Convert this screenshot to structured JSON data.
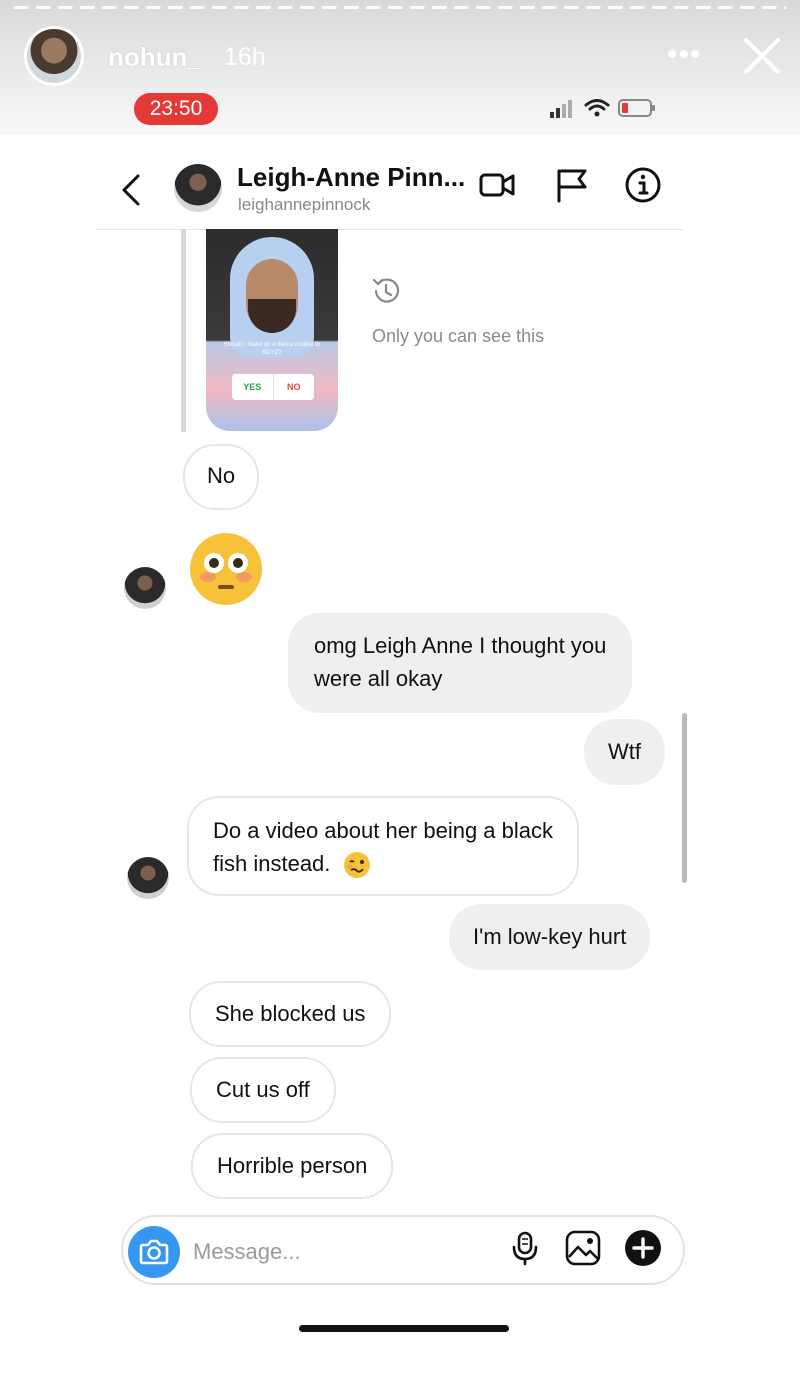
{
  "story": {
    "username": "nohun_",
    "time_ago": "16h",
    "more_icon": "more-dots-icon",
    "close_icon": "close-icon"
  },
  "status_bar": {
    "clock": "23:50",
    "clock_pill_color": "#e53935",
    "icons": [
      "signal-icon",
      "wifi-icon",
      "battery-low-icon"
    ]
  },
  "dm_header": {
    "name": "Leigh-Anne Pinn...",
    "handle": "leighannepinnock",
    "icons": [
      "back-chevron-icon",
      "video-call-icon",
      "flag-icon",
      "info-icon"
    ]
  },
  "shared_story": {
    "poll_question": "Should I make up a dance routine to BOYZ?",
    "poll_yes": "YES",
    "poll_no": "NO",
    "visibility_note": "Only you can see this"
  },
  "messages": [
    {
      "side": "in",
      "text": "No"
    },
    {
      "side": "in",
      "text": "",
      "emoji": "flushed-face"
    },
    {
      "side": "out",
      "text": "omg Leigh Anne I thought you",
      "text2": "were all okay"
    },
    {
      "side": "out",
      "text": "Wtf"
    },
    {
      "side": "in",
      "text": "Do a video about her being a black",
      "text2": "fish instead.",
      "emoji": "woozy-face"
    },
    {
      "side": "out",
      "text": "I'm low-key hurt"
    },
    {
      "side": "in",
      "text": "She blocked us"
    },
    {
      "side": "in",
      "text": "Cut us off"
    },
    {
      "side": "in",
      "text": "Horrible person"
    }
  ],
  "composer": {
    "placeholder": "Message...",
    "icons": [
      "camera-icon",
      "microphone-icon",
      "image-icon",
      "plus-icon"
    ],
    "accent": "#3797f0"
  }
}
